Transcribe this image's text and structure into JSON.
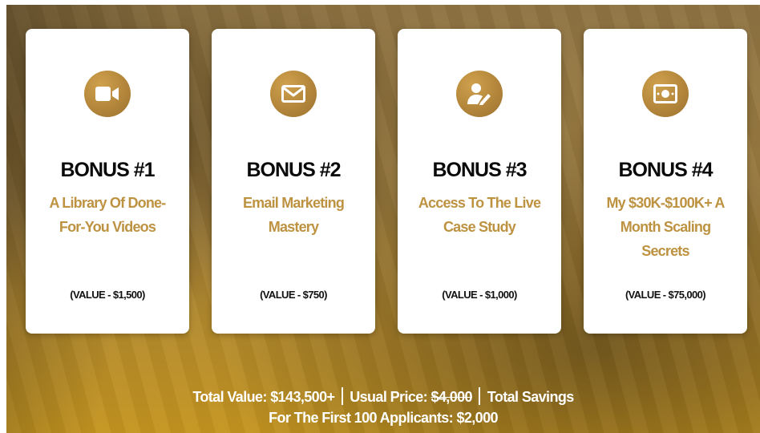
{
  "cards": [
    {
      "title": "BONUS #1",
      "desc": "A Library Of Done-For-You Videos",
      "value": "(VALUE - $1,500)",
      "icon": "video-camera-icon"
    },
    {
      "title": "BONUS #2",
      "desc": "Email Marketing Mastery",
      "value": "(VALUE - $750)",
      "icon": "envelope-icon"
    },
    {
      "title": "BONUS #3",
      "desc": "Access To The Live Case Study",
      "value": "(VALUE - $1,000)",
      "icon": "user-edit-icon"
    },
    {
      "title": "BONUS #4",
      "desc": "My $30K-$100K+ A Month Scaling Secrets",
      "value": "(VALUE - $75,000)",
      "icon": "money-bill-icon"
    }
  ],
  "footer": {
    "total_value": "Total Value: $143,500+",
    "usual_price_label": "Usual Price:",
    "usual_price": "$4,000",
    "savings_label": "Total Savings",
    "line2": "For The First 100 Applicants: $2,000"
  },
  "colors": {
    "accent": "#bd9241",
    "icon_bg": "#b3863b",
    "card_bg": "#ffffff"
  }
}
